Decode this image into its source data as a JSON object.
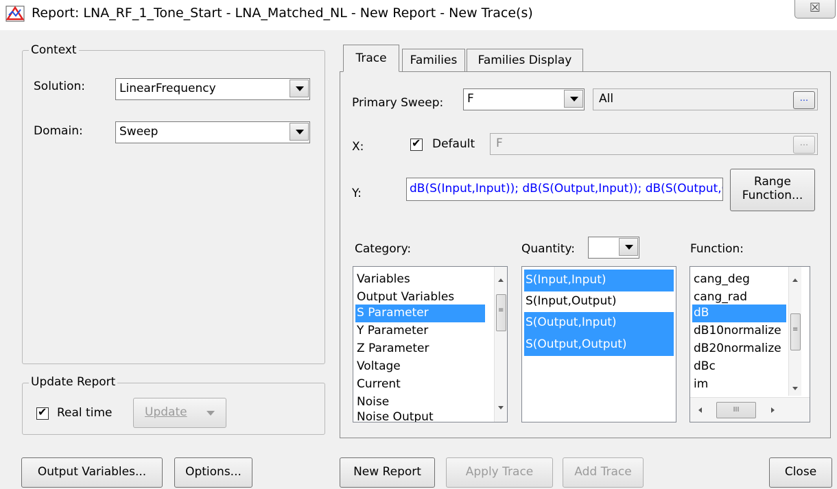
{
  "window": {
    "title": "Report: LNA_RF_1_Tone_Start - LNA_Matched_NL - New Report - New Trace(s)",
    "close_glyph": "☒"
  },
  "context": {
    "group_label": "Context",
    "solution_label": "Solution:",
    "solution_value": "LinearFrequency",
    "domain_label": "Domain:",
    "domain_value": "Sweep"
  },
  "update_report": {
    "group_label": "Update Report",
    "realtime_label": "Real time",
    "realtime_checked": true,
    "update_label": "Update"
  },
  "tabs": [
    "Trace",
    "Families",
    "Families Display"
  ],
  "trace": {
    "primary_sweep_label": "Primary Sweep:",
    "primary_sweep_value": "F",
    "primary_sweep_range": "All",
    "ellipsis": "...",
    "x_label": "X:",
    "default_label": "Default",
    "default_checked": true,
    "x_value": "F",
    "y_label": "Y:",
    "y_value": "dB(S(Input,Input)); dB(S(Output,Input)); dB(S(Output,Output))",
    "range_function_line1": "Range",
    "range_function_line2": "Function...",
    "category_label": "Category:",
    "quantity_label": "Quantity:",
    "function_label": "Function:",
    "categories": [
      "Variables",
      "Output Variables",
      "S Parameter",
      "Y Parameter",
      "Z Parameter",
      "Voltage",
      "Current",
      "Noise",
      "Noise Output"
    ],
    "selected_category": "S Parameter",
    "quantities": [
      {
        "label": "S(Input,Input)",
        "selected": true
      },
      {
        "label": "S(Input,Output)",
        "selected": false
      },
      {
        "label": "S(Output,Input)",
        "selected": true
      },
      {
        "label": "S(Output,Output)",
        "selected": true
      }
    ],
    "functions": [
      "cang_deg",
      "cang_rad",
      "dB",
      "dB10normalize",
      "dB20normalize",
      "dBc",
      "im"
    ],
    "selected_function": "dB"
  },
  "bottom_buttons": {
    "output_variables": "Output Variables...",
    "options": "Options...",
    "new_report": "New Report",
    "apply_trace": "Apply Trace",
    "add_trace": "Add Trace",
    "close": "Close"
  },
  "colors": {
    "selection": "#3399ff",
    "y_text": "#0000ff"
  }
}
